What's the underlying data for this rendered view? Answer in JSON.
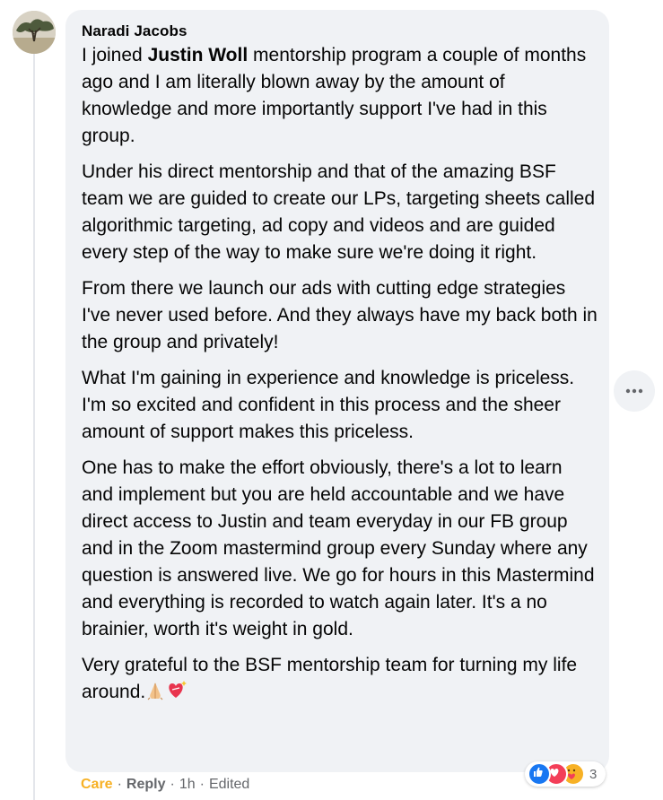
{
  "comment": {
    "author": "Naradi Jacobs",
    "paragraphs": [
      {
        "pre": "I joined ",
        "mention": "Justin Woll",
        "post": " mentorship program a couple of months ago and I am literally blown away by the amount of knowledge and more importantly support I've had in this group."
      },
      {
        "text": "Under his direct mentorship and that of the amazing BSF team we are guided to create our LPs, targeting sheets called algorithmic targeting, ad copy and videos and are guided every step of the way to make sure we're doing it right."
      },
      {
        "text": "From there we launch our ads with cutting edge strategies I've never used before. And they always have my back both in the group and privately!"
      },
      {
        "text": "What I'm gaining in experience and knowledge is priceless. I'm so excited and confident in this process and the sheer amount of support makes this priceless."
      },
      {
        "text": "One has to make the effort obviously, there's a lot to learn and implement but you are held accountable and we have direct access to Justin and team everyday in our FB group and in the Zoom mastermind group every Sunday where any question is answered live. We go for hours in this Mastermind and everything is recorded to watch again later. It's a no brainier, worth it's weight in gold."
      },
      {
        "text": "Very grateful to the BSF mentorship team for turning my life around."
      }
    ],
    "reactions": {
      "count": "3",
      "icons": [
        "like-icon",
        "love-icon",
        "care-icon"
      ],
      "colors": {
        "like": "#1877f2",
        "love": "#f33e58",
        "care": "#f7b125"
      }
    }
  },
  "actions": {
    "care": "Care",
    "reply": "Reply",
    "time": "1h",
    "edited": "Edited",
    "separator": "·"
  },
  "more_button": {
    "icon": "more-horizontal-icon"
  }
}
